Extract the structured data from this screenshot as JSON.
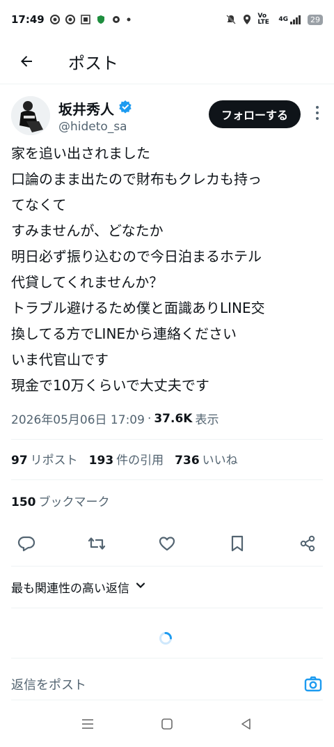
{
  "status_bar": {
    "time": "17:49",
    "volte": "Vo LTE",
    "network": "4G",
    "battery": "29"
  },
  "header": {
    "title": "ポスト"
  },
  "author": {
    "name": "坂井秀人",
    "handle": "@hideto_sa",
    "follow_label": "フォローする"
  },
  "tweet": {
    "lines": [
      "家を追い出されました",
      "口論のまま出たので財布もクレカも持っ",
      "てなくて",
      "すみませんが、どなたか",
      "明日必ず振り込むので今日泊まるホテル",
      "代貸してくれませんか？",
      "トラブル避けるため僕と面識ありLINE交",
      "換してる方でLINEから連絡ください",
      "いま代官山です",
      "現金で10万くらいで大丈夫です"
    ]
  },
  "meta": {
    "timestamp": "2026年05月06日 17:09",
    "separator": "·",
    "views": "37.6K",
    "views_label": "表示"
  },
  "stats": {
    "reposts": "97",
    "reposts_label": "リポスト",
    "quotes": "193",
    "quotes_label": "件の引用",
    "likes": "736",
    "likes_label": "いいね"
  },
  "bookmarks": {
    "count": "150",
    "label": "ブックマーク"
  },
  "sort": {
    "label": "最も関連性の高い返信"
  },
  "reply": {
    "placeholder": "返信をポスト"
  },
  "colors": {
    "accent": "#1d9bf0",
    "text": "#0f1419",
    "muted": "#536471"
  }
}
